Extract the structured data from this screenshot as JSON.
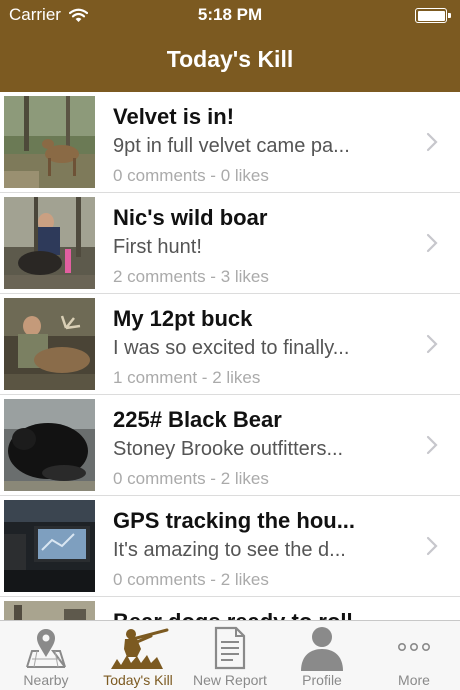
{
  "status_bar": {
    "carrier": "Carrier",
    "time": "5:18 PM"
  },
  "nav": {
    "title": "Today's Kill"
  },
  "colors": {
    "brand": "#7c5a21",
    "tab_inactive": "#8a8a8a",
    "separator": "#dcdcdc"
  },
  "posts": [
    {
      "title": "Velvet is in!",
      "subtitle": "9pt in full velvet came pa...",
      "meta": "0 comments - 0 likes"
    },
    {
      "title": "Nic's wild boar",
      "subtitle": "First hunt!",
      "meta": "2 comments - 3 likes"
    },
    {
      "title": "My 12pt buck",
      "subtitle": "I was so excited to finally...",
      "meta": "1 comment - 2 likes"
    },
    {
      "title": "225# Black Bear",
      "subtitle": "Stoney Brooke outfitters...",
      "meta": "0 comments - 2 likes"
    },
    {
      "title": "GPS tracking the hou...",
      "subtitle": "It's amazing to see the d...",
      "meta": "0 comments - 2 likes"
    },
    {
      "title": "Bear dogs ready to roll",
      "subtitle": "",
      "meta": ""
    }
  ],
  "tabs": [
    {
      "label": "Nearby",
      "icon": "map-pin-icon",
      "active": false
    },
    {
      "label": "Today's Kill",
      "icon": "hunter-icon",
      "active": true
    },
    {
      "label": "New Report",
      "icon": "report-icon",
      "active": false
    },
    {
      "label": "Profile",
      "icon": "person-icon",
      "active": false
    },
    {
      "label": "More",
      "icon": "more-icon",
      "active": false
    }
  ]
}
